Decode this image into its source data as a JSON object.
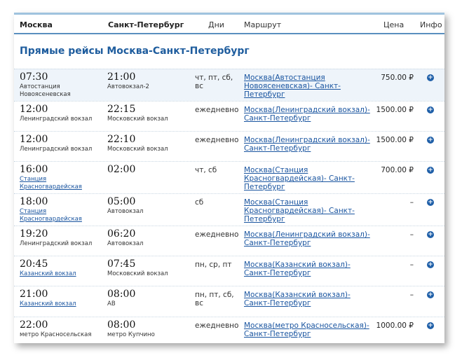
{
  "header": {
    "from": "Москва",
    "to": "Санкт-Петербург",
    "days": "Дни",
    "route": "Маршрут",
    "price": "Цена",
    "info": "Инфо"
  },
  "section_title": "Прямые рейсы Москва-Санкт-Петербург",
  "info_icon_glyph": "+",
  "rows": [
    {
      "dep_time": "07:30",
      "dep_station_lines": [
        "Автостанция",
        "Новоясеневская"
      ],
      "dep_link": false,
      "arr_time": "21:00",
      "arr_station": "Автовокзал-2",
      "days_lines": [
        "чт, пт, сб,",
        "вс"
      ],
      "route_lines": [
        "Москва(Автостанция",
        "Новоясеневская)- Санкт-",
        "Петербург"
      ],
      "price": "750.00 ₽"
    },
    {
      "dep_time": "12:00",
      "dep_station_lines": [
        "Ленинградский вокзал"
      ],
      "dep_link": false,
      "arr_time": "22:15",
      "arr_station": "Московский вокзал",
      "days_lines": [
        "ежедневно"
      ],
      "route_lines": [
        "Москва(Ленинградский вокзал)-",
        "Санкт-Петербург"
      ],
      "price": "1500.00 ₽"
    },
    {
      "dep_time": "12:00",
      "dep_station_lines": [
        "Ленинградский вокзал"
      ],
      "dep_link": false,
      "arr_time": "22:10",
      "arr_station": "Московский вокзал",
      "days_lines": [
        "ежедневно"
      ],
      "route_lines": [
        "Москва(Ленинградский вокзал)-",
        "Санкт-Петербург"
      ],
      "price": "1500.00 ₽"
    },
    {
      "dep_time": "16:00",
      "dep_station_lines": [
        "Станция",
        "Красногвардейская"
      ],
      "dep_link": true,
      "arr_time": "02:00",
      "arr_station": "",
      "days_lines": [
        "чт, сб"
      ],
      "route_lines": [
        "Москва(Станция",
        "Красногвардейская)- Санкт-",
        "Петербург"
      ],
      "price": "700.00 ₽"
    },
    {
      "dep_time": "18:00",
      "dep_station_lines": [
        "Станция",
        "Красногвардейская"
      ],
      "dep_link": true,
      "arr_time": "05:00",
      "arr_station": "Автовокзал",
      "days_lines": [
        "сб"
      ],
      "route_lines": [
        "Москва(Станция",
        "Красногвардейская)- Санкт-",
        "Петербург"
      ],
      "price": "–"
    },
    {
      "dep_time": "19:20",
      "dep_station_lines": [
        "Ленинградский вокзал"
      ],
      "dep_link": false,
      "arr_time": "06:20",
      "arr_station": "Автовокзал",
      "days_lines": [
        "ежедневно"
      ],
      "route_lines": [
        "Москва(Ленинградский вокзал)-",
        "Санкт-Петербург"
      ],
      "price": "–"
    },
    {
      "dep_time": "20:45",
      "dep_station_lines": [
        "Казанский вокзал"
      ],
      "dep_link": true,
      "arr_time": "07:45",
      "arr_station": "Московский вокзал",
      "days_lines": [
        "пн, ср, пт"
      ],
      "route_lines": [
        "Москва(Казанский вокзал)-",
        "Санкт-Петербург"
      ],
      "price": "–"
    },
    {
      "dep_time": "21:00",
      "dep_station_lines": [
        "Казанский вокзал"
      ],
      "dep_link": true,
      "arr_time": "08:00",
      "arr_station": "АВ",
      "days_lines": [
        "пн, пт, сб,",
        "вс"
      ],
      "route_lines": [
        "Москва(Казанский вокзал)-",
        "Санкт-Петербург"
      ],
      "price": "–"
    },
    {
      "dep_time": "22:00",
      "dep_station_lines": [
        "метро Красносельская"
      ],
      "dep_link": false,
      "arr_time": "08:00",
      "arr_station": "метро Купчино",
      "days_lines": [
        "ежедневно"
      ],
      "route_lines": [
        "Москва(метро Красносельская)-",
        "Санкт-Петербург"
      ],
      "price": "1000.00 ₽"
    }
  ],
  "colors": {
    "accent": "#1f5d9e",
    "link": "#1a55a0",
    "highlight_row": "#eef4fa",
    "header_border": "#5a8fbf"
  }
}
